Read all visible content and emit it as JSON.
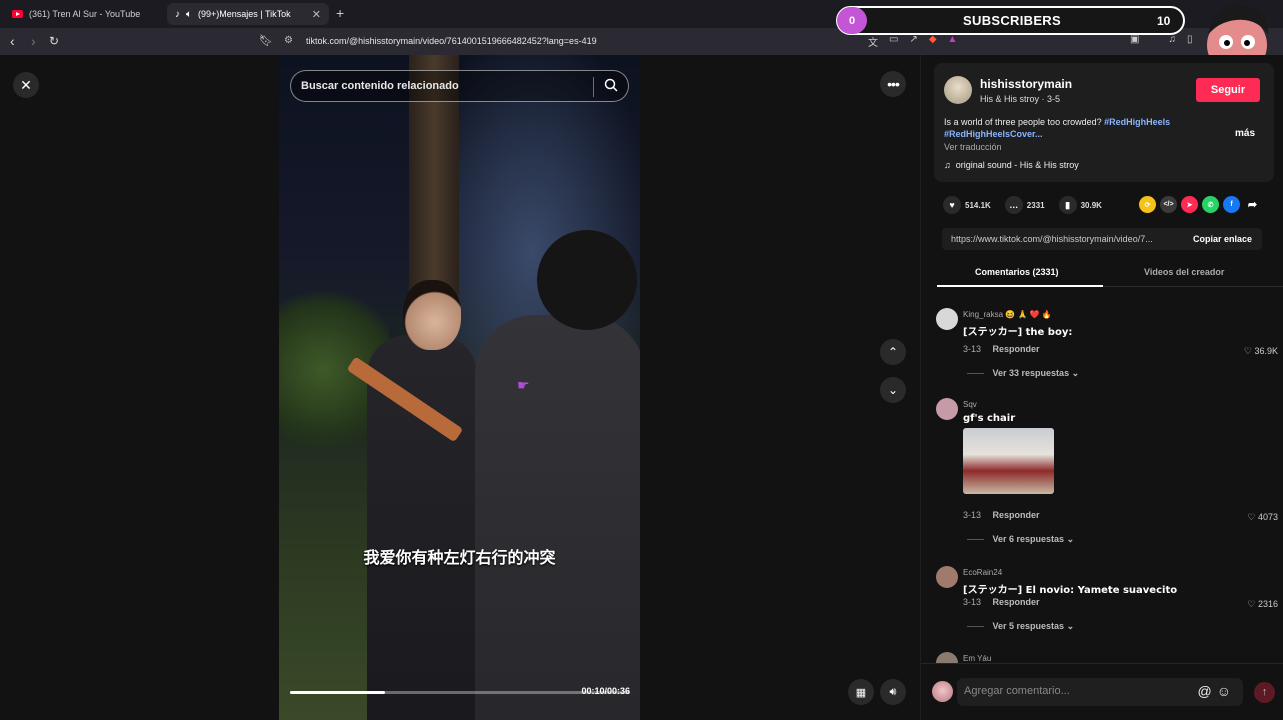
{
  "browser": {
    "tabs": [
      {
        "title": "(361) Tren Al Sur - YouTube",
        "active": false
      },
      {
        "title": "(99+)Mensajes | TikTok",
        "active": true
      }
    ],
    "new_tab": "+",
    "url": "tiktok.com/@hishisstorymain/video/7614001519666482452?lang=es-419"
  },
  "overlay": {
    "subscribers_label": "SUBSCRIBERS",
    "current": "0",
    "goal": "10",
    "bubble_color": "#c455d6"
  },
  "video": {
    "search_placeholder": "Buscar contenido relacionado",
    "subtitle": "我爱你有种左灯右行的冲突",
    "time": "00:10/00:36",
    "progress": 0.28
  },
  "creator": {
    "username": "hishisstorymain",
    "sub": "His & His stroy · 3-5",
    "follow_label": "Seguir",
    "desc_text": "Is a world of three people too crowded? ",
    "hashtag1": "#RedHighHeels",
    "hashtag2": "#RedHighHeelsCover",
    "desc_ellipsis": "...",
    "more_label": "más",
    "translate_label": "Ver traducción",
    "sound": "original sound - His & His stroy"
  },
  "stats": {
    "likes": "514.1K",
    "comments": "2331",
    "saves": "30.9K"
  },
  "share_colors": [
    "#f4c21a",
    "#3a3a3a",
    "#fe2c55",
    "#25d366",
    "#1877f2"
  ],
  "link": {
    "url": "https://www.tiktok.com/@hishisstorymain/video/7...",
    "copy_label": "Copiar enlace"
  },
  "tabs": {
    "comments": "Comentarios (2331)",
    "creator_videos": "Videos del creador"
  },
  "comments": [
    {
      "user": "King_raksa",
      "user_suffix": "😆 🙏 ❤️ 🔥",
      "text": "[ステッカー] the boy:",
      "date": "3-13",
      "reply": "Responder",
      "likes": "36.9K",
      "more": "Ver 33 respuestas"
    },
    {
      "user": "Sqv",
      "user_suffix": "",
      "text": "gf's chair",
      "date": "3-13",
      "reply": "Responder",
      "likes": "4073",
      "more": "Ver 6 respuestas"
    },
    {
      "user": "EcoRain24",
      "user_suffix": "",
      "text": "[ステッカー] El novio: Yamete suavecito",
      "date": "3-13",
      "reply": "Responder",
      "likes": "2316",
      "more": "Ver 5 respuestas"
    },
    {
      "user": "Em Yáu",
      "user_suffix": "",
      "text": "",
      "date": "",
      "reply": "",
      "likes": "",
      "more": ""
    }
  ],
  "add_comment": {
    "placeholder": "Agregar comentario...",
    "mention_icon": "@",
    "emoji_icon": "☺"
  }
}
